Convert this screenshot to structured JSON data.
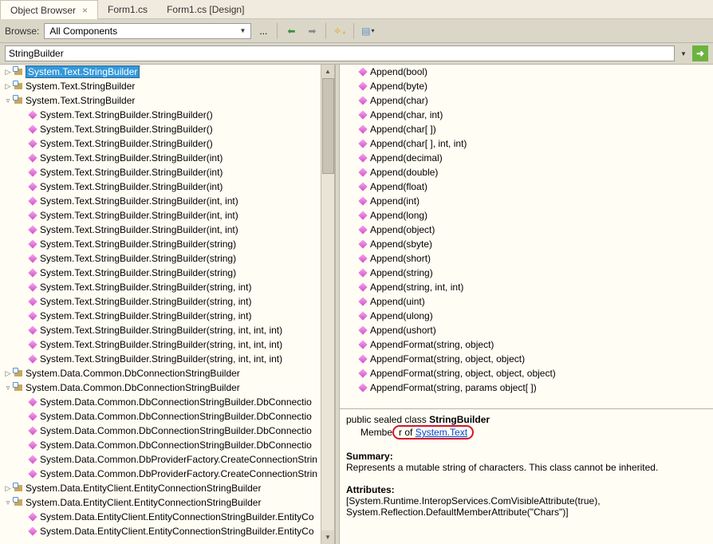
{
  "tabs": [
    {
      "label": "Object Browser",
      "active": true
    },
    {
      "label": "Form1.cs",
      "active": false
    },
    {
      "label": "Form1.cs [Design]",
      "active": false
    }
  ],
  "toolbar": {
    "browse_label": "Browse:",
    "dropdown_value": "All Components",
    "ellipsis": "..."
  },
  "search": {
    "value": "StringBuilder"
  },
  "tree": [
    {
      "depth": 0,
      "expander": "▷",
      "icon": "class",
      "label": "System.Text.StringBuilder",
      "selected": true
    },
    {
      "depth": 0,
      "expander": "▷",
      "icon": "class",
      "label": "System.Text.StringBuilder"
    },
    {
      "depth": 0,
      "expander": "▿",
      "icon": "class",
      "label": "System.Text.StringBuilder"
    },
    {
      "depth": 1,
      "expander": "",
      "icon": "method",
      "label": "System.Text.StringBuilder.StringBuilder()"
    },
    {
      "depth": 1,
      "expander": "",
      "icon": "method",
      "label": "System.Text.StringBuilder.StringBuilder()"
    },
    {
      "depth": 1,
      "expander": "",
      "icon": "method",
      "label": "System.Text.StringBuilder.StringBuilder()"
    },
    {
      "depth": 1,
      "expander": "",
      "icon": "method",
      "label": "System.Text.StringBuilder.StringBuilder(int)"
    },
    {
      "depth": 1,
      "expander": "",
      "icon": "method",
      "label": "System.Text.StringBuilder.StringBuilder(int)"
    },
    {
      "depth": 1,
      "expander": "",
      "icon": "method",
      "label": "System.Text.StringBuilder.StringBuilder(int)"
    },
    {
      "depth": 1,
      "expander": "",
      "icon": "method",
      "label": "System.Text.StringBuilder.StringBuilder(int, int)"
    },
    {
      "depth": 1,
      "expander": "",
      "icon": "method",
      "label": "System.Text.StringBuilder.StringBuilder(int, int)"
    },
    {
      "depth": 1,
      "expander": "",
      "icon": "method",
      "label": "System.Text.StringBuilder.StringBuilder(int, int)"
    },
    {
      "depth": 1,
      "expander": "",
      "icon": "method",
      "label": "System.Text.StringBuilder.StringBuilder(string)"
    },
    {
      "depth": 1,
      "expander": "",
      "icon": "method",
      "label": "System.Text.StringBuilder.StringBuilder(string)"
    },
    {
      "depth": 1,
      "expander": "",
      "icon": "method",
      "label": "System.Text.StringBuilder.StringBuilder(string)"
    },
    {
      "depth": 1,
      "expander": "",
      "icon": "method",
      "label": "System.Text.StringBuilder.StringBuilder(string, int)"
    },
    {
      "depth": 1,
      "expander": "",
      "icon": "method",
      "label": "System.Text.StringBuilder.StringBuilder(string, int)"
    },
    {
      "depth": 1,
      "expander": "",
      "icon": "method",
      "label": "System.Text.StringBuilder.StringBuilder(string, int)"
    },
    {
      "depth": 1,
      "expander": "",
      "icon": "method",
      "label": "System.Text.StringBuilder.StringBuilder(string, int, int, int)"
    },
    {
      "depth": 1,
      "expander": "",
      "icon": "method",
      "label": "System.Text.StringBuilder.StringBuilder(string, int, int, int)"
    },
    {
      "depth": 1,
      "expander": "",
      "icon": "method",
      "label": "System.Text.StringBuilder.StringBuilder(string, int, int, int)"
    },
    {
      "depth": 0,
      "expander": "▷",
      "icon": "class",
      "label": "System.Data.Common.DbConnectionStringBuilder"
    },
    {
      "depth": 0,
      "expander": "▿",
      "icon": "class",
      "label": "System.Data.Common.DbConnectionStringBuilder"
    },
    {
      "depth": 1,
      "expander": "",
      "icon": "method",
      "label": "System.Data.Common.DbConnectionStringBuilder.DbConnectio"
    },
    {
      "depth": 1,
      "expander": "",
      "icon": "method",
      "label": "System.Data.Common.DbConnectionStringBuilder.DbConnectio"
    },
    {
      "depth": 1,
      "expander": "",
      "icon": "method",
      "label": "System.Data.Common.DbConnectionStringBuilder.DbConnectio"
    },
    {
      "depth": 1,
      "expander": "",
      "icon": "method",
      "label": "System.Data.Common.DbConnectionStringBuilder.DbConnectio"
    },
    {
      "depth": 1,
      "expander": "",
      "icon": "method",
      "label": "System.Data.Common.DbProviderFactory.CreateConnectionStrin"
    },
    {
      "depth": 1,
      "expander": "",
      "icon": "method",
      "label": "System.Data.Common.DbProviderFactory.CreateConnectionStrin"
    },
    {
      "depth": 0,
      "expander": "▷",
      "icon": "class",
      "label": "System.Data.EntityClient.EntityConnectionStringBuilder"
    },
    {
      "depth": 0,
      "expander": "▿",
      "icon": "class",
      "label": "System.Data.EntityClient.EntityConnectionStringBuilder"
    },
    {
      "depth": 1,
      "expander": "",
      "icon": "method",
      "label": "System.Data.EntityClient.EntityConnectionStringBuilder.EntityCo"
    },
    {
      "depth": 1,
      "expander": "",
      "icon": "method",
      "label": "System.Data.EntityClient.EntityConnectionStringBuilder.EntityCo"
    }
  ],
  "members": [
    "Append(bool)",
    "Append(byte)",
    "Append(char)",
    "Append(char, int)",
    "Append(char[ ])",
    "Append(char[ ], int, int)",
    "Append(decimal)",
    "Append(double)",
    "Append(float)",
    "Append(int)",
    "Append(long)",
    "Append(object)",
    "Append(sbyte)",
    "Append(short)",
    "Append(string)",
    "Append(string, int, int)",
    "Append(uint)",
    "Append(ulong)",
    "Append(ushort)",
    "AppendFormat(string, object)",
    "AppendFormat(string, object, object)",
    "AppendFormat(string, object, object, object)",
    "AppendFormat(string, params object[ ])"
  ],
  "summary": {
    "declaration_prefix": "public sealed class ",
    "declaration_bold": "StringBuilder",
    "member_of_label": "Member of ",
    "member_of_link": "System.Text",
    "summary_head": "Summary:",
    "summary_text": "Represents a mutable string of characters. This class cannot be inherited.",
    "attr_head": "Attributes:",
    "attr_line1": "[System.Runtime.InteropServices.ComVisibleAttribute(true),",
    "attr_line2": "System.Reflection.DefaultMemberAttribute(\"Chars\")]"
  }
}
